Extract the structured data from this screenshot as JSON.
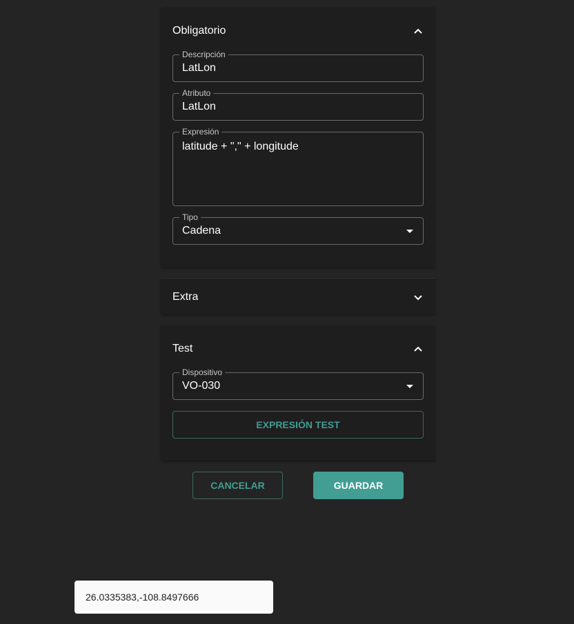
{
  "obligatorio": {
    "title": "Obligatorio",
    "descripcion": {
      "label": "Descripción",
      "value": "LatLon"
    },
    "atributo": {
      "label": "Atributo",
      "value": "LatLon"
    },
    "expresion": {
      "label": "Expresión",
      "value": "latitude + \",\" + longitude"
    },
    "tipo": {
      "label": "Tipo",
      "value": "Cadena"
    }
  },
  "extra": {
    "title": "Extra"
  },
  "test": {
    "title": "Test",
    "dispositivo": {
      "label": "Dispositivo",
      "value": "VO-030"
    },
    "button": "EXPRESIÓN TEST"
  },
  "actions": {
    "cancel": "CANCELAR",
    "save": "GUARDAR"
  },
  "snackbar": {
    "message": "26.0335383,-108.8497666"
  },
  "colors": {
    "accent": "#429e93"
  }
}
